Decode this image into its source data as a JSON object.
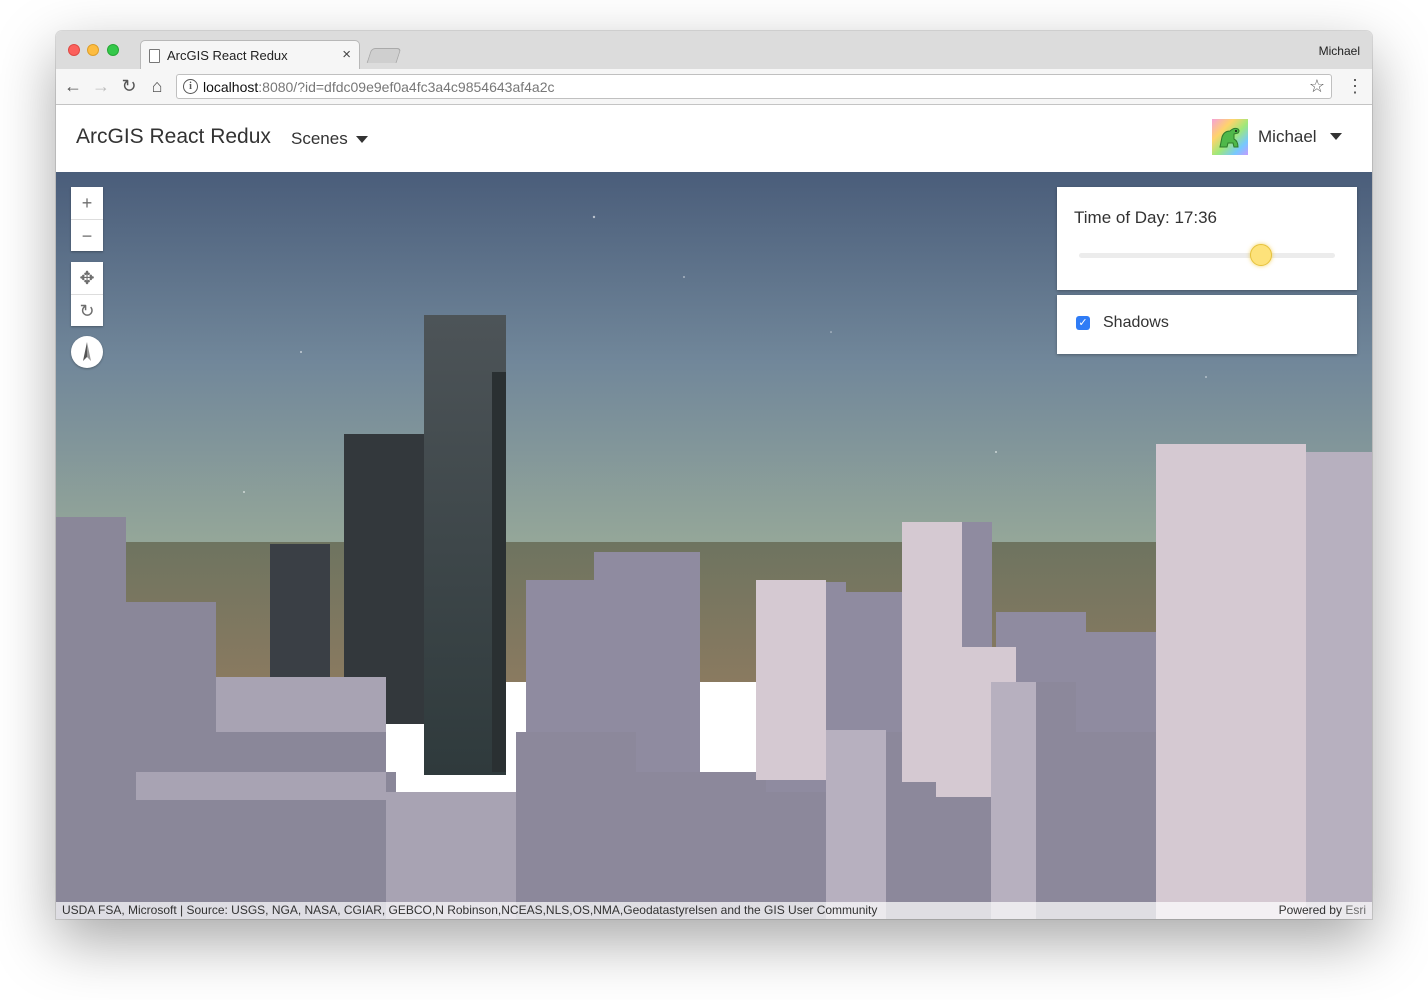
{
  "browser": {
    "tab_title": "ArcGIS React Redux",
    "profile_name": "Michael",
    "url_host": "localhost",
    "url_rest": ":8080/?id=dfdc09e9ef0a4fc3a4c9854643af4a2c"
  },
  "app": {
    "brand": "ArcGIS React Redux",
    "scenes_label": "Scenes",
    "user_name": "Michael"
  },
  "map": {
    "time_label": "Time of Day: 17:36",
    "time_of_day_fraction": 0.71,
    "shadows_label": "Shadows",
    "shadows_checked": true,
    "attribution": "USDA FSA, Microsoft | Source: USGS, NGA, NASA, CGIAR, GEBCO,N Robinson,NCEAS,NLS,OS,NMA,Geodatastyrelsen and the GIS User Community",
    "powered_by": "Powered by",
    "esri_link": "Esri"
  },
  "icons": {
    "back": "arrow-left-icon",
    "forward": "arrow-right-icon",
    "reload": "reload-icon",
    "home": "home-icon",
    "info": "info-icon",
    "star": "star-icon",
    "menu": "kebab-menu-icon",
    "zoom_in": "plus-icon",
    "zoom_out": "minus-icon",
    "pan": "pan-icon",
    "rotate": "rotate-icon",
    "compass": "compass-icon"
  },
  "colors": {
    "checkbox_accent": "#2f7cf6",
    "slider_thumb": "#fde27a",
    "sky_top": "#4a5d7a",
    "sky_horizon": "#95a799",
    "buildings": "#8e8a9e"
  }
}
